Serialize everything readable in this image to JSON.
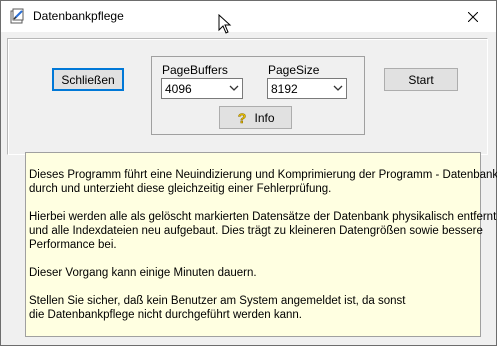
{
  "window": {
    "title": "Datenbankpflege"
  },
  "buttons": {
    "close_label": "Schließen",
    "start_label": "Start",
    "info_label": "Info"
  },
  "settings": {
    "page_buffers": {
      "label": "PageBuffers",
      "value": "4096"
    },
    "page_size": {
      "label": "PageSize",
      "value": "8192"
    }
  },
  "info_text": {
    "paragraph1_line1": "Dieses Programm führt eine Neuindizierung und Komprimierung der Programm - Datenbank",
    "paragraph1_line2": "durch und unterzieht diese gleichzeitig einer Fehlerprüfung.",
    "paragraph2_line1": "Hierbei werden alle als gelöscht markierten Datensätze der Datenbank physikalisch entfernt",
    "paragraph2_line2": "und alle Indexdateien neu aufgebaut. Dies trägt zu kleineren Datengrößen sowie bessere",
    "paragraph2_line3": "Performance bei.",
    "paragraph3_line1": "Dieser Vorgang kann einige Minuten dauern.",
    "paragraph4_line1": "Stellen Sie sicher, daß kein Benutzer am System angemeldet ist, da sonst",
    "paragraph4_line2": "die Datenbankpflege nicht durchgeführt werden kann."
  },
  "colors": {
    "info_background": "#ffffe1",
    "default_button_border": "#0078d7",
    "help_icon": "#e8c000"
  },
  "icons": {
    "app": "database-app-icon",
    "close": "close-icon",
    "help": "question-mark-icon",
    "dropdown": "chevron-down-icon",
    "cursor": "mouse-pointer-icon"
  }
}
